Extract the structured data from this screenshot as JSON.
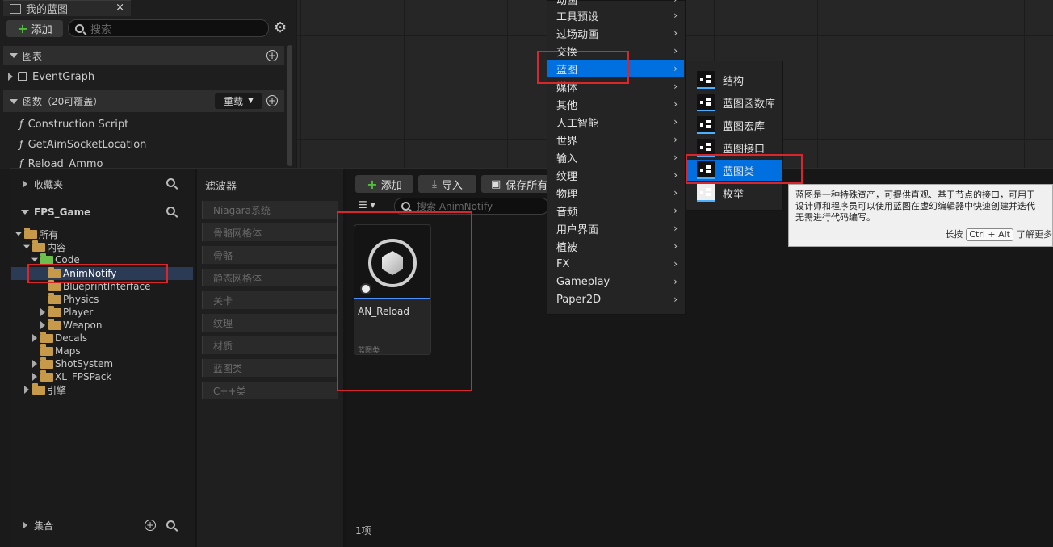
{
  "my_blueprint": {
    "tab_label": "我的蓝图",
    "close_glyph": "×",
    "add_label": "添加",
    "search_placeholder": "搜索",
    "graphs_header": "图表",
    "event_graph": "EventGraph",
    "functions_header": "函数（20可覆盖）",
    "override_label": "重载",
    "functions": [
      "Construction Script",
      "GetAimSocketLocation",
      "Reload_Ammo"
    ]
  },
  "content_browser": {
    "favorites_label": "收藏夹",
    "project_label": "FPS_Game",
    "collections_label": "集合",
    "tree": [
      {
        "label": "所有",
        "depth": 0
      },
      {
        "label": "内容",
        "depth": 1
      },
      {
        "label": "Code",
        "depth": 2
      },
      {
        "label": "AnimNotify",
        "depth": 3
      },
      {
        "label": "BlueprintInterface",
        "depth": 3
      },
      {
        "label": "Physics",
        "depth": 3
      },
      {
        "label": "Player",
        "depth": 3
      },
      {
        "label": "Weapon",
        "depth": 3
      },
      {
        "label": "Decals",
        "depth": 2
      },
      {
        "label": "Maps",
        "depth": 2
      },
      {
        "label": "ShotSystem",
        "depth": 2
      },
      {
        "label": "XL_FPSPack",
        "depth": 2
      },
      {
        "label": "引擎",
        "depth": 1
      }
    ],
    "filters_title": "滤波器",
    "filters": [
      "Niagara系统",
      "骨骼网格体",
      "骨骼",
      "静态网格体",
      "关卡",
      "纹理",
      "材质",
      "蓝图类",
      "C++类"
    ],
    "toolbar": {
      "add": "添加",
      "import": "导入",
      "save_all": "保存所有"
    },
    "search_placeholder": "搜索 AnimNotify",
    "asset": {
      "name": "AN_Reload",
      "type": "蓝图类"
    },
    "item_count": "1项"
  },
  "context_menu": {
    "items": [
      "动画",
      "工具预设",
      "过场动画",
      "交换",
      "蓝图",
      "媒体",
      "其他",
      "人工智能",
      "世界",
      "输入",
      "纹理",
      "物理",
      "音频",
      "用户界面",
      "植被",
      "FX",
      "Gameplay",
      "Paper2D"
    ],
    "selected": "蓝图"
  },
  "submenu": {
    "items": [
      "结构",
      "蓝图函数库",
      "蓝图宏库",
      "蓝图接口",
      "蓝图类",
      "枚举"
    ],
    "selected": "蓝图类"
  },
  "tooltip": {
    "line1": "蓝图是一种特殊资产，可提供直观、基于节点的接口，可用于",
    "line2": "设计师和程序员可以使用蓝图在虚幻编辑器中快速创建并迭代",
    "line3": "无需进行代码编写。",
    "hint_prefix": "长按",
    "hint_key": "Ctrl + Alt",
    "hint_suffix": "了解更多"
  },
  "colors": {
    "accent": "#0070e0",
    "highlight_box": "#d9262c",
    "folder": "#c79a4a"
  }
}
